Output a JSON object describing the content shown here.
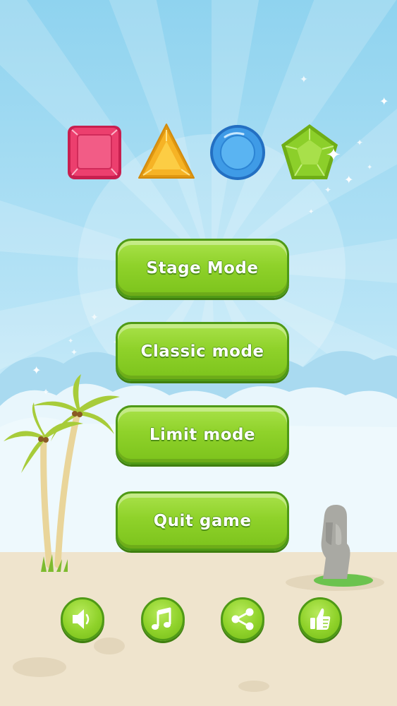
{
  "menu": {
    "stage_mode": "Stage Mode",
    "classic_mode": "Classic mode",
    "limit_mode": "Limit mode",
    "quit_game": "Quit game"
  },
  "gems": [
    {
      "name": "red-square-gem",
      "color": "#ec3f6e"
    },
    {
      "name": "yellow-triangle-gem",
      "color": "#f6b325"
    },
    {
      "name": "blue-circle-gem",
      "color": "#3f9be6"
    },
    {
      "name": "green-pentagon-gem",
      "color": "#8ccf2a"
    }
  ],
  "bottom_buttons": [
    {
      "name": "sound-button",
      "icon": "speaker-icon"
    },
    {
      "name": "music-button",
      "icon": "music-note-icon"
    },
    {
      "name": "share-button",
      "icon": "share-icon"
    },
    {
      "name": "like-button",
      "icon": "thumbs-up-icon"
    }
  ],
  "colors": {
    "button_green": "#8fd22a",
    "button_border": "#4f9a16",
    "sky": "#8fd3ef",
    "sand": "#efe4cd"
  }
}
